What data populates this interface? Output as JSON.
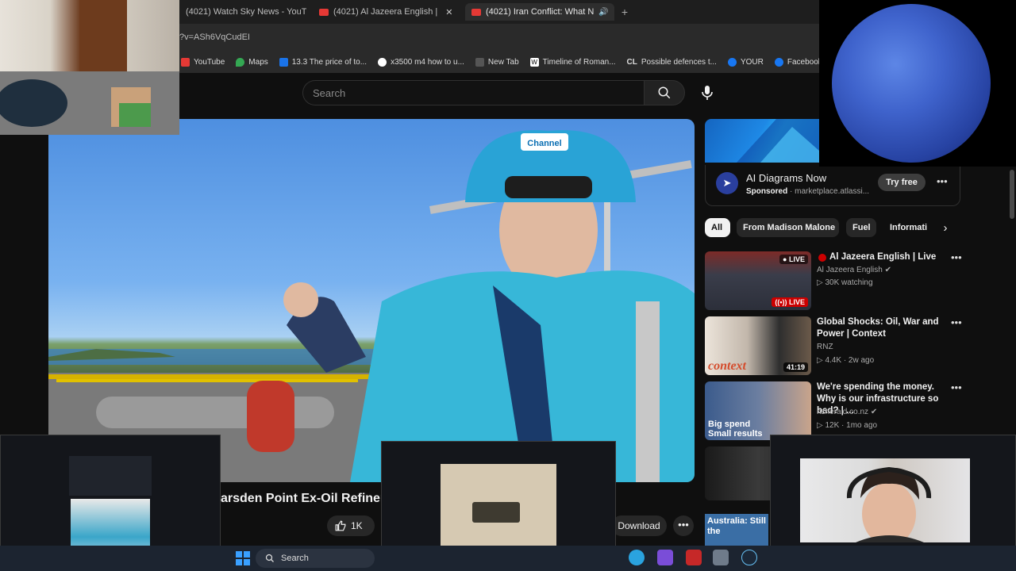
{
  "browser": {
    "tabs": [
      {
        "label": "(4021) Watch Sky News - YouTu",
        "active": false
      },
      {
        "label": "(4021) Al Jazeera English |",
        "active": false
      },
      {
        "label": "(4021) Iran Conflict: What N",
        "active": true
      }
    ],
    "address": "?v=ASh6VqCudEI",
    "bookmarks": [
      "YouTube",
      "Maps",
      "13.3 The price of to...",
      "x3500 m4 how to u...",
      "New Tab",
      "Timeline of Roman...",
      "Possible defences t...",
      "YOUR",
      "Facebook gr"
    ],
    "bookmark_icon_labels": [
      "CL"
    ]
  },
  "search": {
    "placeholder": "Search"
  },
  "video": {
    "title_visible": "arsden Point Ex-Oil Refinery",
    "likes": "1K",
    "download_label": "Download",
    "helmet_text": "Channel"
  },
  "ad": {
    "title": "AI Diagrams Now",
    "sponsored_label": "Sponsored",
    "domain": "· marketplace.atlassi...",
    "cta": "Try free"
  },
  "chips": [
    "All",
    "From Madison Malone",
    "Fuel",
    "Informati"
  ],
  "recommendations": [
    {
      "title": "Al Jazeera English | Live",
      "channel": "Al Jazeera English",
      "meta": "30K watching",
      "badge": "LIVE",
      "live": true
    },
    {
      "title": "Global Shocks: Oil, War and Power | Context",
      "channel": "RNZ",
      "meta": "4.4K · 2w ago",
      "badge": "41:19",
      "thumb_text": "context"
    },
    {
      "title": "We're spending the money. Why is our infrastructure so bad? | ...",
      "channel": "nzherald.co.nz",
      "meta": "12K · 1mo ago",
      "thumb_text": "Big spend Small results"
    },
    {
      "title": "",
      "channel": "",
      "meta": "",
      "thumb_text": "Australia: Still the"
    }
  ],
  "taskbar": {
    "search_placeholder": "Search"
  },
  "colors": {
    "live_red": "#cc0000",
    "accent_blue": "#3ea6ff",
    "background": "#0f0f0f"
  }
}
